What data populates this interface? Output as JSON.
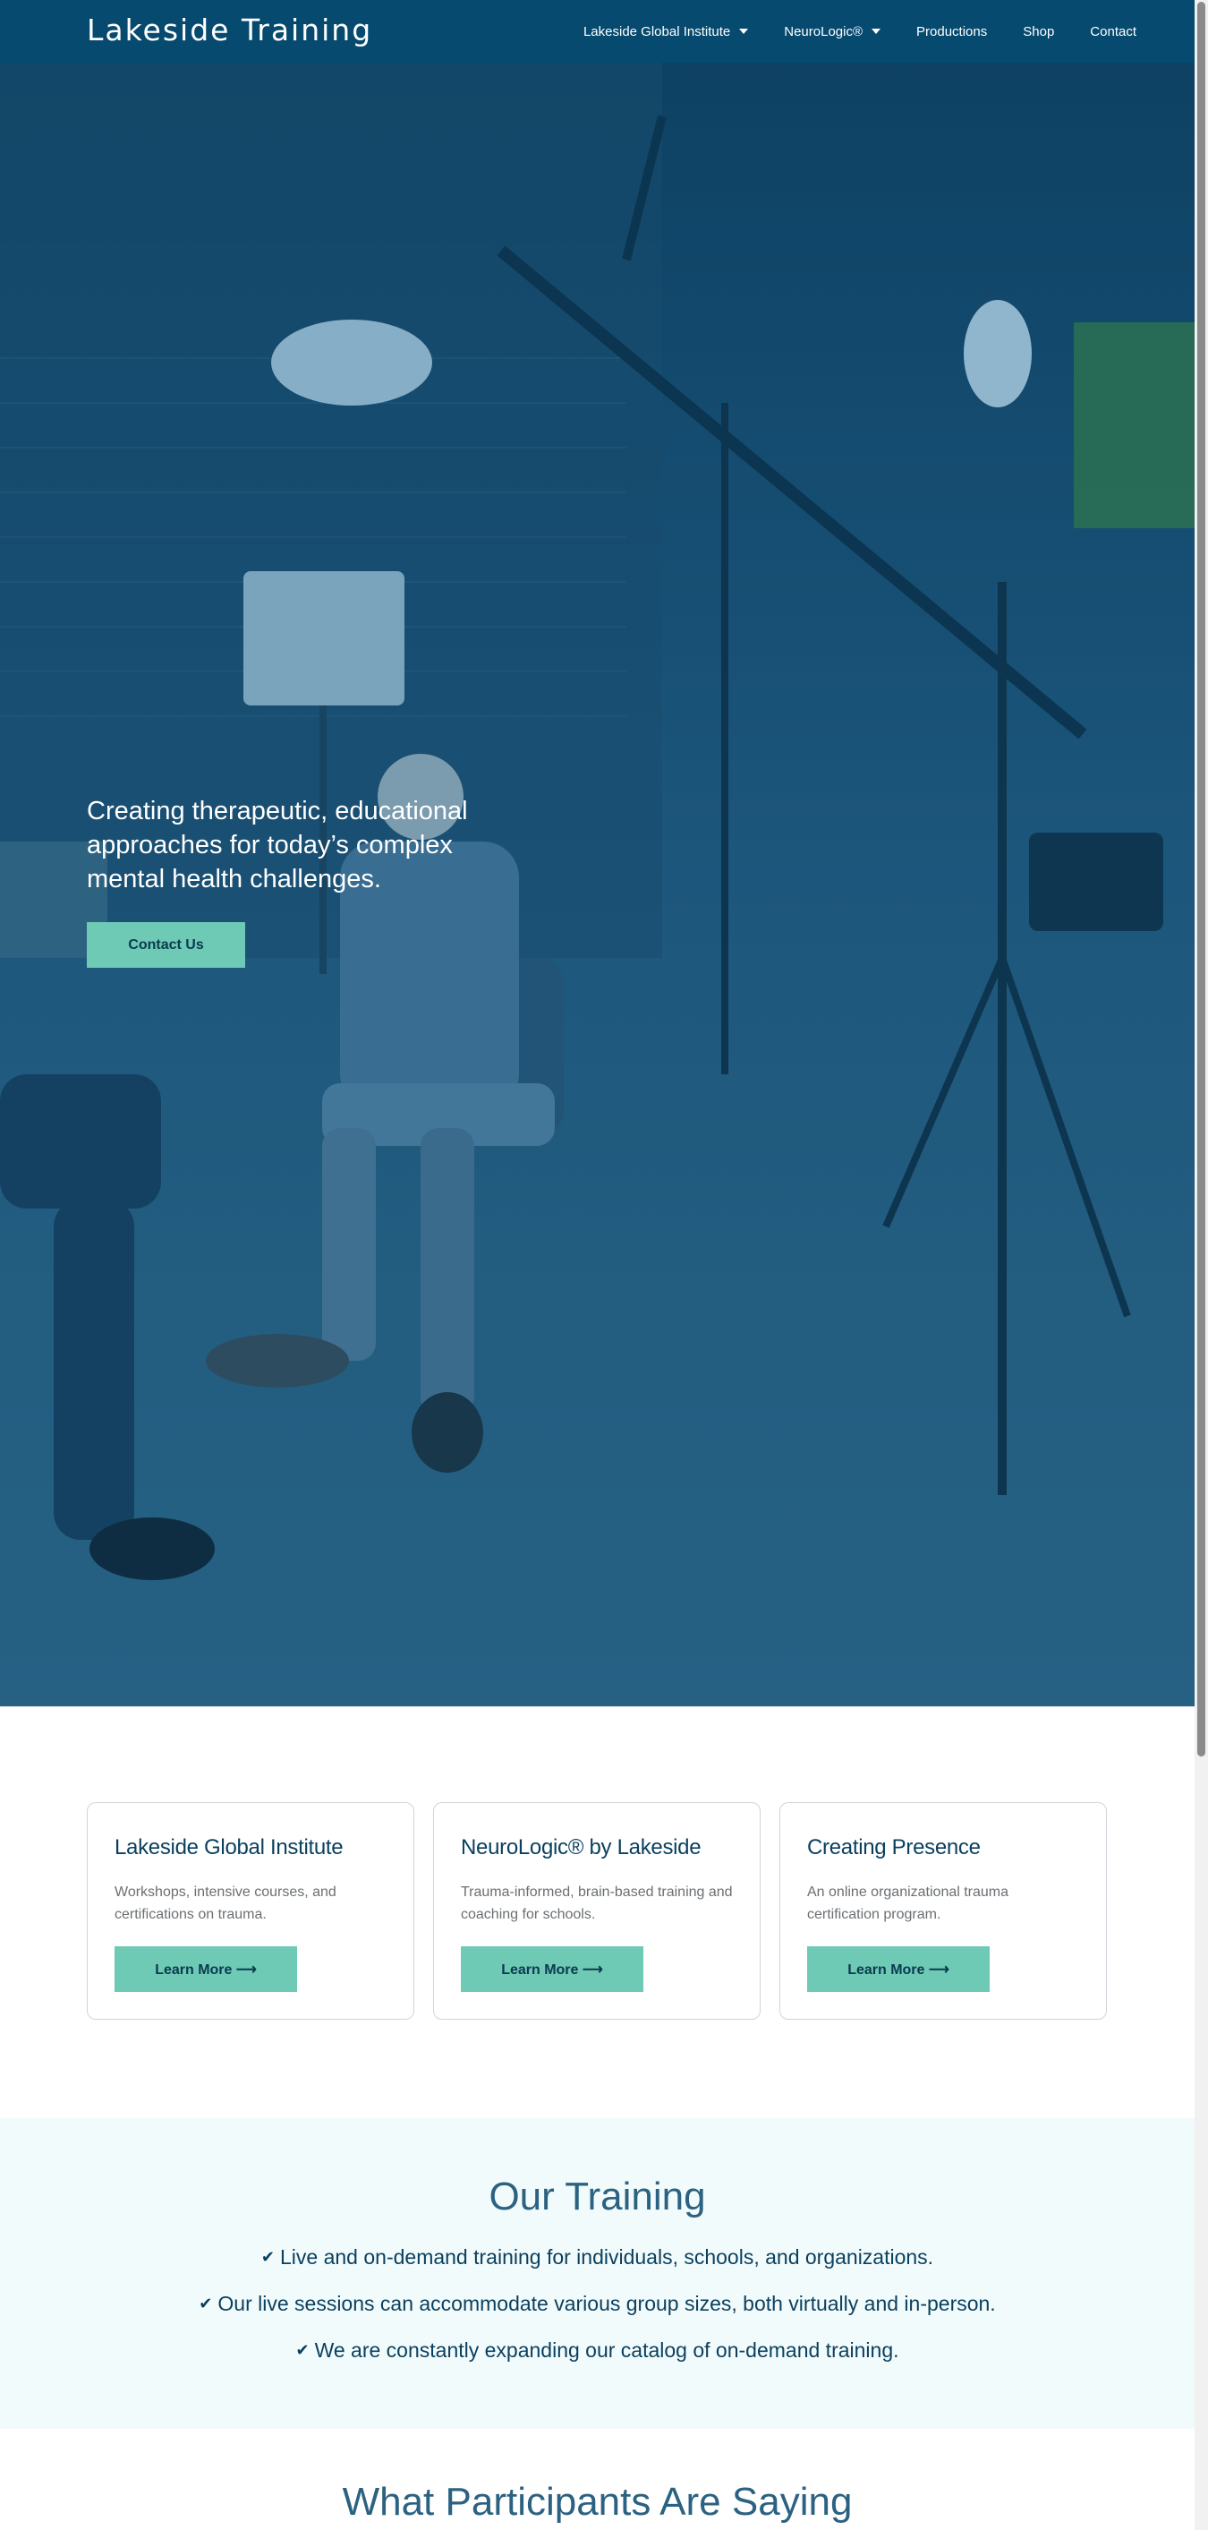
{
  "header": {
    "logo": "Lakeside Training",
    "nav": [
      {
        "label": "Lakeside Global Institute",
        "has_dropdown": true
      },
      {
        "label": "NeuroLogic®",
        "has_dropdown": true
      },
      {
        "label": "Productions",
        "has_dropdown": false
      },
      {
        "label": "Shop",
        "has_dropdown": false
      },
      {
        "label": "Contact",
        "has_dropdown": false
      }
    ],
    "background_color": "#064a6f"
  },
  "hero": {
    "tagline": "Creating therapeutic, educational approaches for today’s complex mental health challenges.",
    "cta_label": "Contact Us",
    "accent_color": "#6ec9b5"
  },
  "cards": [
    {
      "title": "Lakeside Global Institute",
      "description": "Workshops, intensive courses, and certifications on trauma.",
      "button_label": "Learn More ⟶"
    },
    {
      "title": "NeuroLogic® by Lakeside",
      "description": "Trauma-informed, brain-based training and coaching for schools.",
      "button_label": "Learn More ⟶"
    },
    {
      "title": "Creating Presence",
      "description": "An online organizational trauma certification program.",
      "button_label": "Learn More ⟶"
    }
  ],
  "training": {
    "title": "Our Training",
    "items": [
      "Live and on-demand training for individuals, schools, and organizations.",
      "Our live sessions can accommodate various group sizes, both virtually and in-person.",
      "We are constantly expanding our catalog of on-demand training."
    ],
    "check_icon": "check-icon",
    "background_color": "#f1fbfb"
  },
  "testimonials": {
    "title": "What Participants Are Saying"
  }
}
